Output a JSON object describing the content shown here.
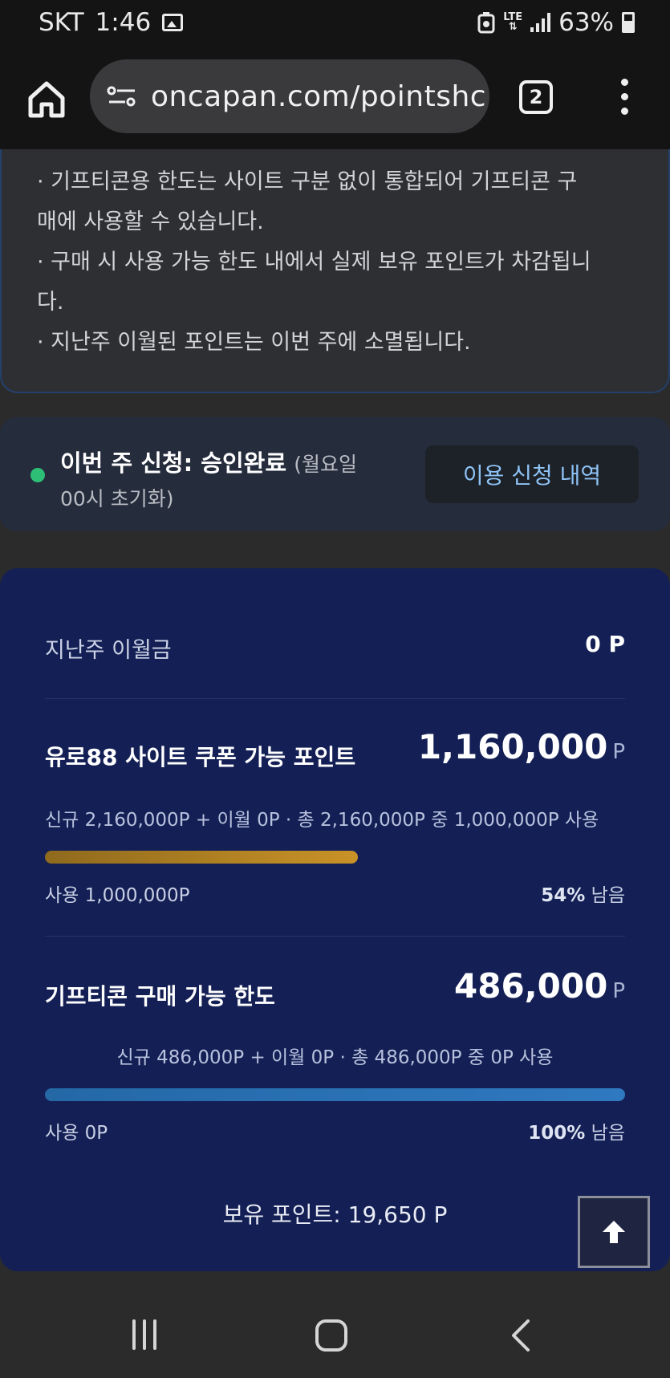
{
  "status_bar": {
    "carrier": "SKT",
    "time": "1:46",
    "network": "LTE",
    "battery": "63%",
    "icons": [
      "gallery-icon",
      "data-saver-icon",
      "signal-icon",
      "battery-icon"
    ]
  },
  "browser": {
    "url": "oncapan.com/pointshc",
    "tab_count": "2"
  },
  "notes": [
    "· 기프티콘용 한도는 사이트 구분 없이 통합되어 기프티콘 구",
    "매에 사용할 수 있습니다.",
    "· 구매 시 사용 가능 한도 내에서 실제 보유 포인트가 차감됩니",
    "다.",
    "· 지난주 이월된 포인트는 이번 주에 소멸됩니다."
  ],
  "approval": {
    "status_title": "이번 주 신청: 승인완료",
    "note_part1": "(월요일",
    "note_part2": "00시 초기화)",
    "history_button": "이용 신청 내역",
    "status_color": "#2dbf75"
  },
  "points": {
    "carryover_label": "지난주 이월금",
    "carryover_value": "0 P",
    "euro88": {
      "label": "유로88 사이트 쿠폰 가능 포인트",
      "value": "1,160,000",
      "unit": "P",
      "detail": "신규 2,160,000P + 이월 0P · 총 2,160,000P 중 1,000,000P 사용",
      "used_label": "사용 1,000,000P",
      "remaining_pct": "54%",
      "remaining_suffix": "남음",
      "remaining_fraction": 0.54
    },
    "gifticon": {
      "label": "기프티콘 구매 가능 한도",
      "value": "486,000",
      "unit": "P",
      "detail": "신규 486,000P + 이월 0P · 총 486,000P 중 0P 사용",
      "used_label": "사용 0P",
      "remaining_pct": "100%",
      "remaining_suffix": "남음",
      "remaining_fraction": 1.0
    },
    "holding": "보유 포인트: 19,650 P"
  },
  "colors": {
    "panel_bg": "#142055",
    "gold_bar": "#c99227",
    "blue_bar": "#2f79c0",
    "accent_link": "#8ec3f5"
  }
}
